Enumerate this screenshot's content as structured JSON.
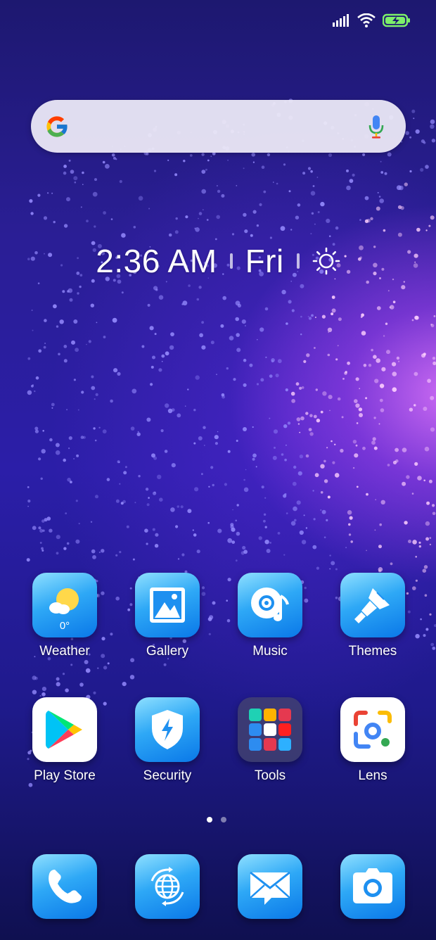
{
  "status_bar": {
    "signal_icon": "signal-icon",
    "wifi_icon": "wifi-icon",
    "battery_icon": "battery-charging-icon"
  },
  "search": {
    "placeholder": "",
    "logo_icon": "google-g-icon",
    "mic_icon": "microphone-icon"
  },
  "clock": {
    "time": "2:36 AM",
    "day": "Fri",
    "weather_icon": "sun-icon"
  },
  "apps_row1": [
    {
      "label": "Weather",
      "icon": "weather-icon",
      "badge": "0°"
    },
    {
      "label": "Gallery",
      "icon": "gallery-icon"
    },
    {
      "label": "Music",
      "icon": "music-icon"
    },
    {
      "label": "Themes",
      "icon": "paintbrush-icon"
    }
  ],
  "apps_row2": [
    {
      "label": "Play Store",
      "icon": "play-store-icon"
    },
    {
      "label": "Security",
      "icon": "shield-icon"
    },
    {
      "label": "Tools",
      "icon": "folder-icon"
    },
    {
      "label": "Lens",
      "icon": "lens-icon"
    }
  ],
  "page_indicator": {
    "pages": 2,
    "current": 1
  },
  "dock": [
    {
      "icon": "phone-icon"
    },
    {
      "icon": "browser-icon"
    },
    {
      "icon": "messaging-icon"
    },
    {
      "icon": "camera-icon"
    }
  ],
  "colors": {
    "icon_blue": "#1a8cf0",
    "background_top": "#1d1870",
    "background_glow": "#e678ff"
  }
}
